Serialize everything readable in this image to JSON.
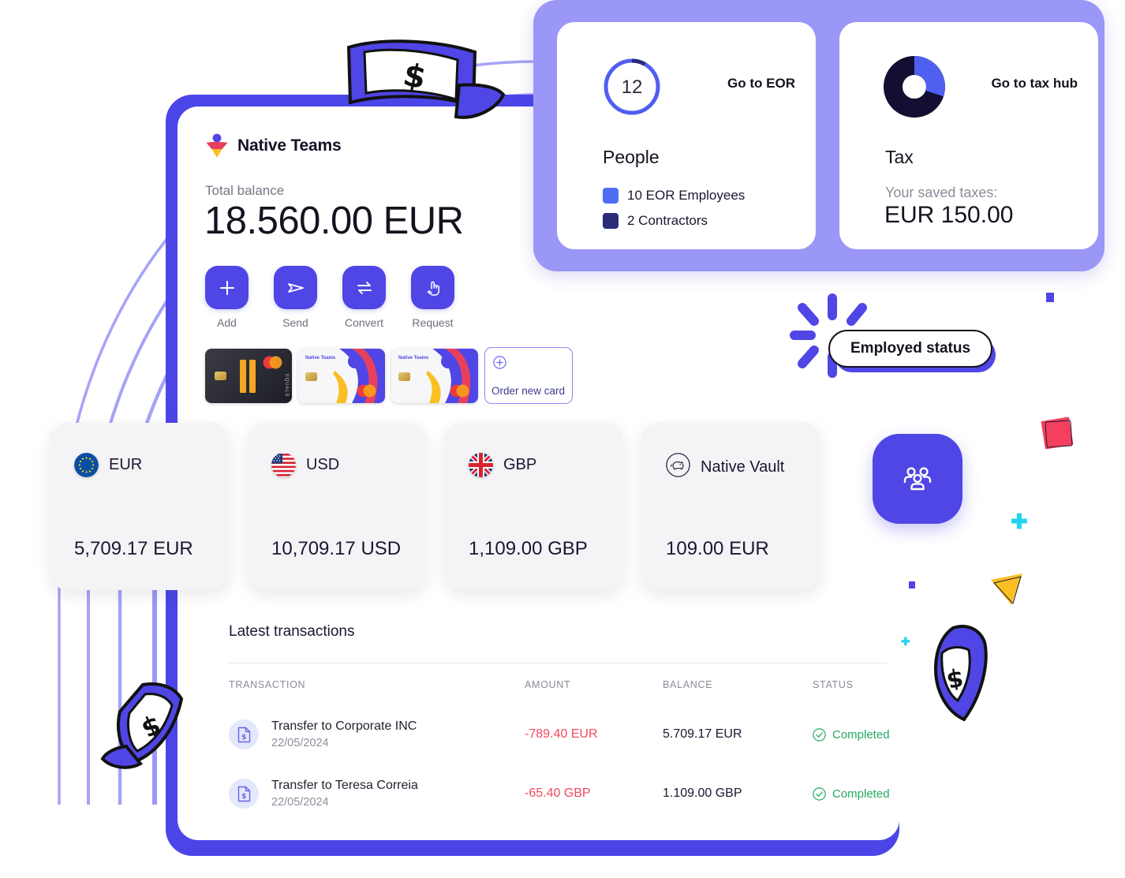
{
  "brand": {
    "name": "Native Teams",
    "logo_icon": "native-teams-logo-icon"
  },
  "balance": {
    "label": "Total balance",
    "amount": "18.560.00 EUR"
  },
  "actions": [
    {
      "label": "Add",
      "icon": "plus-icon"
    },
    {
      "label": "Send",
      "icon": "send-paper-plane-icon"
    },
    {
      "label": "Convert",
      "icon": "convert-arrows-icon"
    },
    {
      "label": "Request",
      "icon": "hand-tap-icon"
    }
  ],
  "payment_cards": {
    "black_card": {
      "brand_mark": "mastercard-icon",
      "issuer_text": "EQUALS"
    },
    "white_card_1": {
      "label": "Native Teams",
      "brand_mark": "mastercard-icon"
    },
    "white_card_2": {
      "label": "Native Teams",
      "brand_mark": "mastercard-icon"
    },
    "order_card": {
      "label": "Order new card",
      "icon": "plus-circle-icon"
    }
  },
  "eor_card": {
    "link": "Go to EOR",
    "donut_value": "12",
    "title": "People",
    "legend": [
      {
        "label": "10 EOR Employees",
        "color": "#4f6ef5"
      },
      {
        "label": "2 Contractors",
        "color": "#2b2b7a"
      }
    ]
  },
  "tax_card": {
    "link": "Go to tax hub",
    "title": "Tax",
    "saved_label": "Your saved taxes:",
    "saved_value": "EUR 150.00",
    "donut_colors": {
      "blue": "#4f5ff0",
      "navy": "#120f33"
    }
  },
  "currencies": [
    {
      "code": "EUR",
      "amount": "5,709.17 EUR",
      "icon": "eu-flag-icon"
    },
    {
      "code": "USD",
      "amount": "10,709.17 USD",
      "icon": "us-flag-icon"
    },
    {
      "code": "GBP",
      "amount": "1,109.00 GBP",
      "icon": "uk-flag-icon"
    },
    {
      "code": "Native Vault",
      "amount": "109.00 EUR",
      "icon": "piggy-bank-icon"
    }
  ],
  "transactions": {
    "title": "Latest transactions",
    "columns": [
      "TRANSACTION",
      "AMOUNT",
      "BALANCE",
      "STATUS"
    ],
    "rows": [
      {
        "name": "Transfer to Corporate INC",
        "date": "22/05/2024",
        "amount": "-789.40 EUR",
        "balance": "5.709.17 EUR",
        "status": "Completed",
        "icon": "document-dollar-icon",
        "status_icon": "check-circle-icon"
      },
      {
        "name": "Transfer to Teresa Correia",
        "date": "22/05/2024",
        "amount": "-65.40 GBP",
        "balance": "1.109.00 GBP",
        "status": "Completed",
        "icon": "document-dollar-icon",
        "status_icon": "check-circle-icon"
      }
    ]
  },
  "badge": {
    "label": "Employed status"
  },
  "fab": {
    "icon": "people-group-icon"
  },
  "colors": {
    "primary": "#4f46e5",
    "frame": "#4b45e8",
    "panel": "#9a97f7",
    "navy": "#120f33",
    "negative": "#f04a5c",
    "positive": "#24a862",
    "cyan": "#22d3ee",
    "pink": "#f43f5e",
    "yellow": "#fbbf24"
  }
}
